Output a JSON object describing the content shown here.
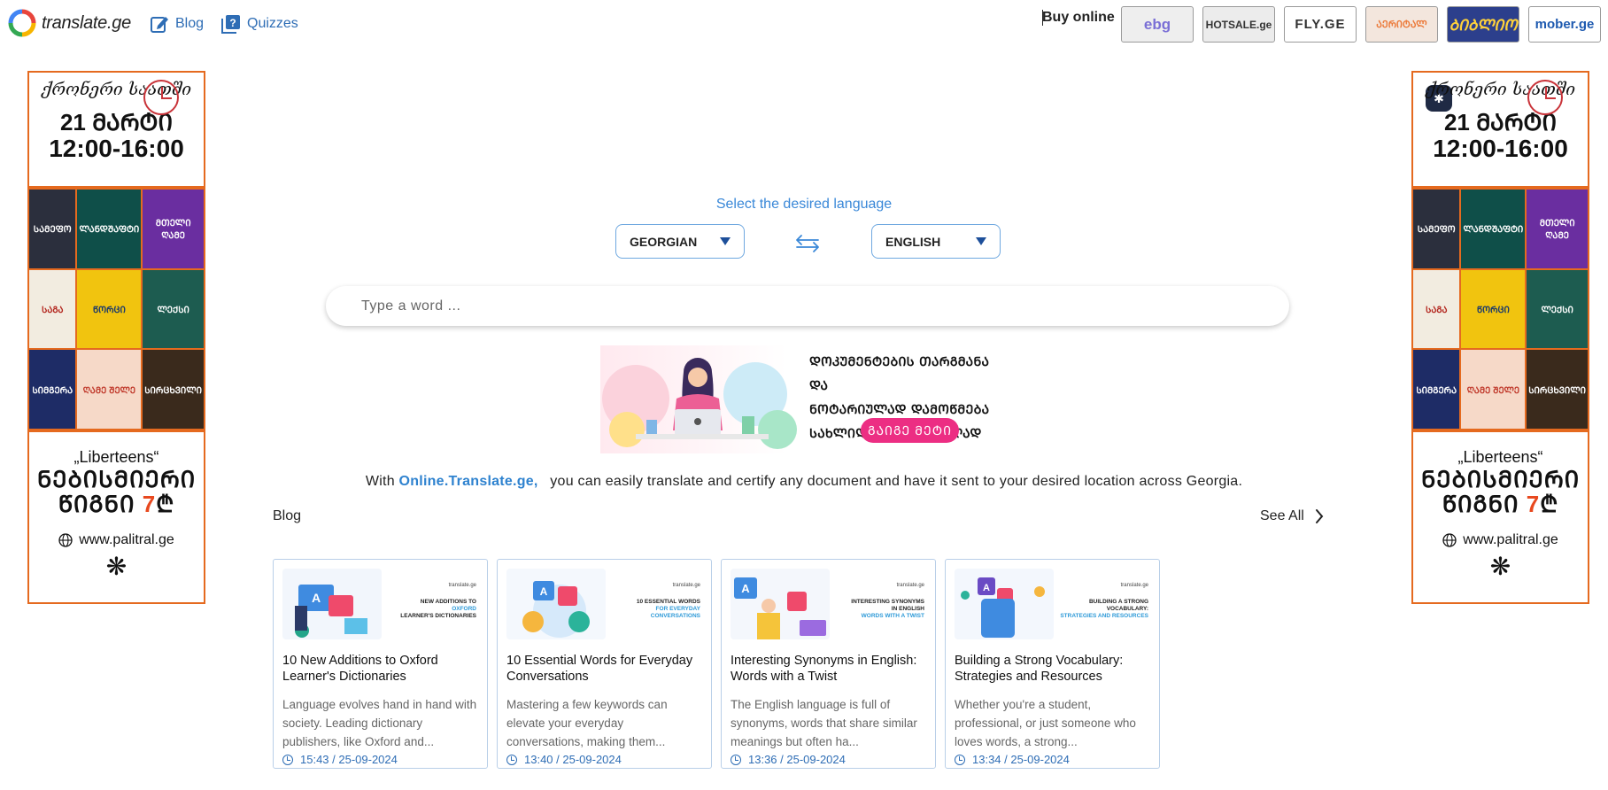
{
  "header": {
    "logo_text": "translate.ge",
    "nav": [
      {
        "label": "Blog",
        "icon": "edit-icon"
      },
      {
        "label": "Quizzes",
        "icon": "quiz-icon"
      }
    ],
    "buy_online_label": "Buy online",
    "shops": [
      "ebg",
      "HOTSALE.ge",
      "FLY.GE",
      "ᲐᲔᲠᲘᲢᲐᲚ",
      "ᲑᲘᲑᲚᲘᲝ",
      "mober.ge"
    ]
  },
  "side_ad": {
    "script_title": "ქრონერი საათში",
    "date": "21 ᲛᲐᲠᲢᲘ",
    "time": "12:00-16:00",
    "books": [
      "ᲡᲐᲛᲔᲤᲝ",
      "ᲚᲐᲜᲓᲨᲐᲤᲢᲘ",
      "ᲛᲗᲔᲚᲘ ᲦᲐᲛᲔ",
      "ᲡᲐᲒᲐ",
      "ᲬᲝᲠᲪᲘ",
      "ᲚᲔᲥᲡᲘ",
      "ᲡᲘᲛᲒᲔᲠᲐ",
      "ᲦᲐᲛᲔ ᲨᲔᲚᲔ",
      "ᲡᲘᲠᲪᲮᲕᲘᲚᲘ"
    ],
    "library": "„Liberteens“",
    "free_word": "ᲜᲔᲑᲘᲡᲛᲘᲔᲠᲘ",
    "book_word": "ᲬᲘᲒᲜᲘ",
    "price_digit": "7",
    "currency": "₾",
    "website": "www.palitral.ge",
    "ornament": "❋"
  },
  "translator": {
    "select_label": "Select the desired language",
    "from_lang": "GEORGIAN",
    "to_lang": "ENGLISH",
    "search_placeholder": "Type a word ..."
  },
  "banner": {
    "text_line1": "ᲓᲝᲙᲣᲛᲔᲜᲢᲔᲑᲘᲡ ᲗᲐᲠᲒᲛᲐᲜᲐ ᲓᲐ",
    "text_line2": "ᲜᲝᲢᲐᲠᲘᲣᲚᲐᲓ ᲓᲐᲛᲝᲬᲛᲔᲑᲐ",
    "text_line3": "ᲡᲐᲮᲚᲘᲓᲐᲜ ᲒᲐᲣᲡᲕᲚᲔᲚᲐᲓ",
    "button": "ᲒᲐᲘᲒᲔ ᲛᲔᲢᲘ"
  },
  "promo": {
    "prefix": "With",
    "link": "Online.Translate.ge,",
    "suffix": "you can easily translate and certify any document and have it sent to your desired location across Georgia."
  },
  "blog": {
    "heading": "Blog",
    "see_all": "See All",
    "posts": [
      {
        "brand": "translate.ge",
        "caption_top": "NEW ADDITIONS TO",
        "caption_accent": "OXFORD",
        "caption_rest": "LEARNER'S DICTIONARIES",
        "title": "10 New Additions to Oxford Learner's Dictionaries",
        "excerpt": "Language evolves hand in hand with society. Leading dictionary publishers, like Oxford and...",
        "time": "15:43 / 25-09-2024"
      },
      {
        "brand": "translate.ge",
        "caption_top": "10 ESSENTIAL WORDS",
        "caption_accent": "FOR EVERYDAY",
        "caption_rest": "CONVERSATIONS",
        "title": "10 Essential Words for Everyday Conversations",
        "excerpt": "Mastering a few keywords can elevate your everyday conversations, making them...",
        "time": "13:40 / 25-09-2024"
      },
      {
        "brand": "translate.ge",
        "caption_top": "INTERESTING SYNONYMS",
        "caption_accent": "IN ENGLISH",
        "caption_rest": "WORDS WITH A TWIST",
        "title": "Interesting Synonyms in English: Words with a Twist",
        "excerpt": "The English language is full of synonyms, words that share similar meanings but often ha...",
        "time": "13:36 / 25-09-2024"
      },
      {
        "brand": "translate.ge",
        "caption_top": "BUILDING A STRONG VOCABULARY:",
        "caption_accent": "STRATEGIES AND RESOURCES",
        "caption_rest": "",
        "title": "Building a Strong Vocabulary: Strategies and Resources",
        "excerpt": "Whether you're a student, professional, or just someone who loves words, a strong...",
        "time": "13:34 / 25-09-2024"
      }
    ]
  },
  "colors": {
    "accent_blue": "#2e6db5",
    "label_blue": "#3a88d8",
    "ad_orange": "#e56a1f",
    "banner_pink": "#ec2e83"
  }
}
